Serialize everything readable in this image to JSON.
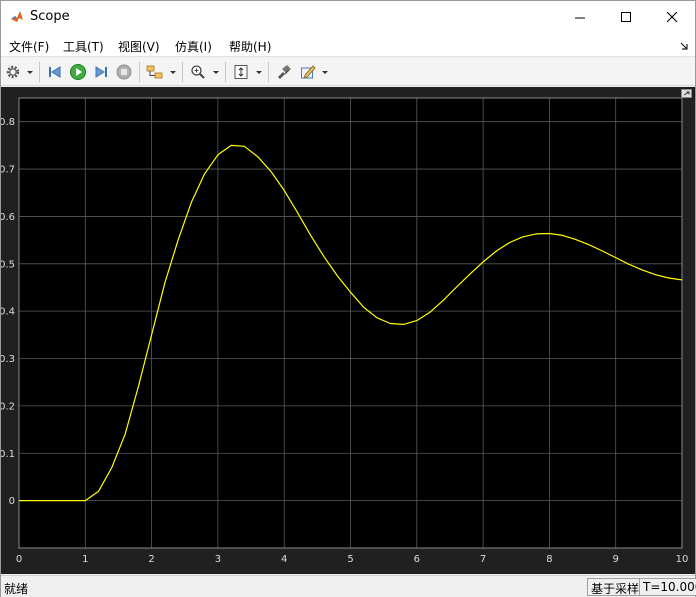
{
  "window": {
    "title": "Scope",
    "controls": [
      "minimize-icon",
      "maximize-icon",
      "close-icon"
    ]
  },
  "menu": {
    "items": [
      {
        "label": "文件(F)"
      },
      {
        "label": "工具(T)"
      },
      {
        "label": "视图(V)"
      },
      {
        "label": "仿真(I)"
      },
      {
        "label": "帮助(H)"
      }
    ]
  },
  "toolbar": {
    "buttons": [
      {
        "icon": "settings-gear-icon",
        "dropdown": true
      },
      {
        "icon": "step-back-icon"
      },
      {
        "icon": "run-icon",
        "color": "#2e9e2e"
      },
      {
        "icon": "step-forward-icon"
      },
      {
        "icon": "stop-icon",
        "enabled": false
      },
      {
        "icon": "signal-selector-icon",
        "dropdown": true
      },
      {
        "icon": "zoom-in-icon",
        "dropdown": true
      },
      {
        "icon": "autoscale-icon",
        "dropdown": true
      },
      {
        "icon": "highlight-simulink-block-icon"
      },
      {
        "icon": "style-pen-icon",
        "dropdown": true
      }
    ]
  },
  "chart_data": {
    "type": "line",
    "title": "",
    "xlabel": "",
    "ylabel": "",
    "xlim": [
      0,
      10
    ],
    "ylim": [
      -0.1,
      0.85
    ],
    "xticks": [
      "0",
      "1",
      "2",
      "3",
      "4",
      "5",
      "6",
      "7",
      "8",
      "9",
      "10"
    ],
    "yticks": [
      "0",
      "0.1",
      "0.2",
      "0.3",
      "0.4",
      "0.5",
      "0.6",
      "0.7",
      "0.8"
    ],
    "grid": true,
    "background": "#000000",
    "line_color": "#ffff00",
    "series": [
      {
        "x": [
          0,
          1.0,
          1.2,
          1.4,
          1.6,
          1.8,
          2.0,
          2.2,
          2.4,
          2.6,
          2.8,
          3.0,
          3.2,
          3.4,
          3.6,
          3.8,
          4.0,
          4.2,
          4.4,
          4.6,
          4.8,
          5.0,
          5.2,
          5.4,
          5.6,
          5.8,
          6.0,
          6.2,
          6.4,
          6.6,
          6.8,
          7.0,
          7.2,
          7.4,
          7.6,
          7.8,
          8.0,
          8.2,
          8.4,
          8.6,
          8.8,
          9.0,
          9.2,
          9.4,
          9.6,
          9.8,
          10.0
        ],
        "y": [
          0,
          0,
          0.02,
          0.07,
          0.14,
          0.24,
          0.35,
          0.46,
          0.55,
          0.63,
          0.69,
          0.73,
          0.75,
          0.748,
          0.726,
          0.695,
          0.655,
          0.608,
          0.56,
          0.515,
          0.475,
          0.44,
          0.408,
          0.386,
          0.374,
          0.372,
          0.38,
          0.398,
          0.423,
          0.451,
          0.478,
          0.504,
          0.527,
          0.545,
          0.557,
          0.563,
          0.564,
          0.56,
          0.551,
          0.54,
          0.527,
          0.513,
          0.499,
          0.487,
          0.477,
          0.47,
          0.466
        ]
      }
    ]
  },
  "status": {
    "left_text": "就绪",
    "mode_text": "基于采样",
    "time_text": "T=10.000"
  }
}
